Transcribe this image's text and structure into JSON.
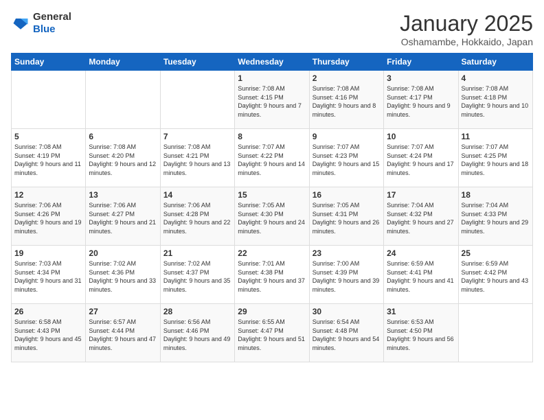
{
  "logo": {
    "text_general": "General",
    "text_blue": "Blue"
  },
  "title": "January 2025",
  "subtitle": "Oshamambe, Hokkaido, Japan",
  "weekdays": [
    "Sunday",
    "Monday",
    "Tuesday",
    "Wednesday",
    "Thursday",
    "Friday",
    "Saturday"
  ],
  "weeks": [
    [
      {
        "day": "",
        "info": ""
      },
      {
        "day": "",
        "info": ""
      },
      {
        "day": "",
        "info": ""
      },
      {
        "day": "1",
        "info": "Sunrise: 7:08 AM\nSunset: 4:15 PM\nDaylight: 9 hours and 7 minutes."
      },
      {
        "day": "2",
        "info": "Sunrise: 7:08 AM\nSunset: 4:16 PM\nDaylight: 9 hours and 8 minutes."
      },
      {
        "day": "3",
        "info": "Sunrise: 7:08 AM\nSunset: 4:17 PM\nDaylight: 9 hours and 9 minutes."
      },
      {
        "day": "4",
        "info": "Sunrise: 7:08 AM\nSunset: 4:18 PM\nDaylight: 9 hours and 10 minutes."
      }
    ],
    [
      {
        "day": "5",
        "info": "Sunrise: 7:08 AM\nSunset: 4:19 PM\nDaylight: 9 hours and 11 minutes."
      },
      {
        "day": "6",
        "info": "Sunrise: 7:08 AM\nSunset: 4:20 PM\nDaylight: 9 hours and 12 minutes."
      },
      {
        "day": "7",
        "info": "Sunrise: 7:08 AM\nSunset: 4:21 PM\nDaylight: 9 hours and 13 minutes."
      },
      {
        "day": "8",
        "info": "Sunrise: 7:07 AM\nSunset: 4:22 PM\nDaylight: 9 hours and 14 minutes."
      },
      {
        "day": "9",
        "info": "Sunrise: 7:07 AM\nSunset: 4:23 PM\nDaylight: 9 hours and 15 minutes."
      },
      {
        "day": "10",
        "info": "Sunrise: 7:07 AM\nSunset: 4:24 PM\nDaylight: 9 hours and 17 minutes."
      },
      {
        "day": "11",
        "info": "Sunrise: 7:07 AM\nSunset: 4:25 PM\nDaylight: 9 hours and 18 minutes."
      }
    ],
    [
      {
        "day": "12",
        "info": "Sunrise: 7:06 AM\nSunset: 4:26 PM\nDaylight: 9 hours and 19 minutes."
      },
      {
        "day": "13",
        "info": "Sunrise: 7:06 AM\nSunset: 4:27 PM\nDaylight: 9 hours and 21 minutes."
      },
      {
        "day": "14",
        "info": "Sunrise: 7:06 AM\nSunset: 4:28 PM\nDaylight: 9 hours and 22 minutes."
      },
      {
        "day": "15",
        "info": "Sunrise: 7:05 AM\nSunset: 4:30 PM\nDaylight: 9 hours and 24 minutes."
      },
      {
        "day": "16",
        "info": "Sunrise: 7:05 AM\nSunset: 4:31 PM\nDaylight: 9 hours and 26 minutes."
      },
      {
        "day": "17",
        "info": "Sunrise: 7:04 AM\nSunset: 4:32 PM\nDaylight: 9 hours and 27 minutes."
      },
      {
        "day": "18",
        "info": "Sunrise: 7:04 AM\nSunset: 4:33 PM\nDaylight: 9 hours and 29 minutes."
      }
    ],
    [
      {
        "day": "19",
        "info": "Sunrise: 7:03 AM\nSunset: 4:34 PM\nDaylight: 9 hours and 31 minutes."
      },
      {
        "day": "20",
        "info": "Sunrise: 7:02 AM\nSunset: 4:36 PM\nDaylight: 9 hours and 33 minutes."
      },
      {
        "day": "21",
        "info": "Sunrise: 7:02 AM\nSunset: 4:37 PM\nDaylight: 9 hours and 35 minutes."
      },
      {
        "day": "22",
        "info": "Sunrise: 7:01 AM\nSunset: 4:38 PM\nDaylight: 9 hours and 37 minutes."
      },
      {
        "day": "23",
        "info": "Sunrise: 7:00 AM\nSunset: 4:39 PM\nDaylight: 9 hours and 39 minutes."
      },
      {
        "day": "24",
        "info": "Sunrise: 6:59 AM\nSunset: 4:41 PM\nDaylight: 9 hours and 41 minutes."
      },
      {
        "day": "25",
        "info": "Sunrise: 6:59 AM\nSunset: 4:42 PM\nDaylight: 9 hours and 43 minutes."
      }
    ],
    [
      {
        "day": "26",
        "info": "Sunrise: 6:58 AM\nSunset: 4:43 PM\nDaylight: 9 hours and 45 minutes."
      },
      {
        "day": "27",
        "info": "Sunrise: 6:57 AM\nSunset: 4:44 PM\nDaylight: 9 hours and 47 minutes."
      },
      {
        "day": "28",
        "info": "Sunrise: 6:56 AM\nSunset: 4:46 PM\nDaylight: 9 hours and 49 minutes."
      },
      {
        "day": "29",
        "info": "Sunrise: 6:55 AM\nSunset: 4:47 PM\nDaylight: 9 hours and 51 minutes."
      },
      {
        "day": "30",
        "info": "Sunrise: 6:54 AM\nSunset: 4:48 PM\nDaylight: 9 hours and 54 minutes."
      },
      {
        "day": "31",
        "info": "Sunrise: 6:53 AM\nSunset: 4:50 PM\nDaylight: 9 hours and 56 minutes."
      },
      {
        "day": "",
        "info": ""
      }
    ]
  ]
}
